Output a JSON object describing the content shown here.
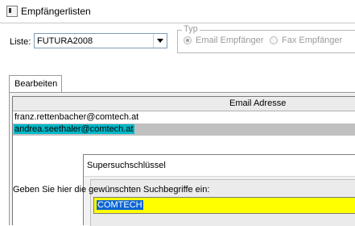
{
  "window": {
    "title": "Empfängerlisten",
    "icon": "app-window-icon"
  },
  "liste": {
    "label": "Liste:",
    "selected": "FUTURA2008"
  },
  "typ": {
    "legend": "Typ",
    "options": [
      {
        "label": "Email Empfänger",
        "checked": true
      },
      {
        "label": "Fax Empfänger",
        "checked": false
      }
    ],
    "disabled": true
  },
  "tabs": [
    {
      "label": "Bearbeiten",
      "active": true
    }
  ],
  "list": {
    "column_header": "Email Adresse",
    "rows": [
      {
        "email": "franz.rettenbacher@comtech.at",
        "selected": false
      },
      {
        "email": "andrea.seethaler@comtech.at",
        "selected": true
      }
    ]
  },
  "dialog": {
    "title": "Supersuchschlüssel",
    "prompt": "Geben Sie hier die gewünschten Suchbegriffe ein:",
    "input_value": "COMTECH",
    "input_color": "#ffff00",
    "selection_color": "#0a64d6"
  },
  "colors": {
    "row_highlight": "#00b8c8",
    "row_selected_bg": "#c0c0c0"
  }
}
